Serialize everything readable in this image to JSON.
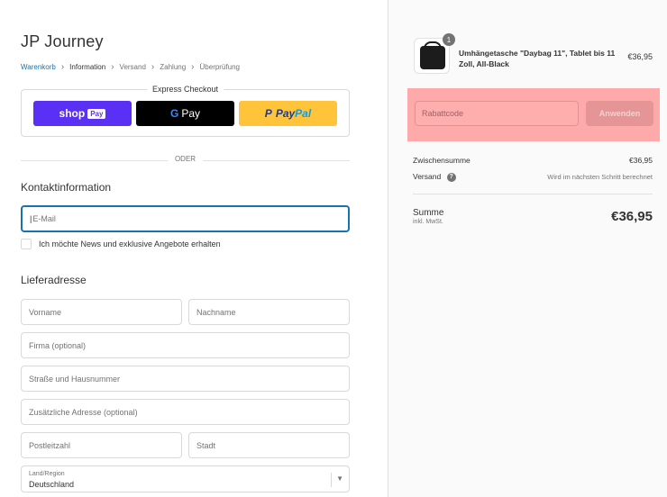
{
  "shop": {
    "title": "JP Journey"
  },
  "breadcrumb": [
    "Warenkorb",
    "Information",
    "Versand",
    "Zahlung",
    "Überprüfung"
  ],
  "express_checkout": {
    "label": "Express Checkout",
    "shop_pay": {
      "text": "shop",
      "tag": "Pay"
    },
    "google_pay": {
      "g": "G",
      "text": "Pay"
    },
    "paypal": {
      "part1": "Pay",
      "part2": "Pal"
    }
  },
  "separator": "ODER",
  "contact": {
    "title": "Kontaktinformation",
    "email_placeholder": "E-Mail",
    "newsletter_label": "Ich möchte News und exklusive Angebote erhalten"
  },
  "shipping": {
    "title": "Lieferadresse",
    "first_name": "Vorname",
    "last_name": "Nachname",
    "company": "Firma (optional)",
    "street": "Straße und Hausnummer",
    "address2": "Zusätzliche Adresse (optional)",
    "zip": "Postleitzahl",
    "city": "Stadt",
    "country_label": "Land/Region",
    "country_value": "Deutschland"
  },
  "summary": {
    "product": {
      "name": "Umhängetasche \"Daybag 11\", Tablet bis 11 Zoll, All-Black",
      "price": "€36,95",
      "quantity": "1"
    },
    "discount_placeholder": "Rabattcode",
    "apply_label": "Anwenden",
    "subtotal_label": "Zwischensumme",
    "subtotal_value": "€36,95",
    "shipping_label": "Versand",
    "shipping_value": "Wird im nächsten Schritt berechnet",
    "total_label": "Summe",
    "total_sub": "inkl. MwSt.",
    "total_value": "€36,95"
  },
  "colors": {
    "accent": "#1773b0",
    "shop_pay": "#5a31f4",
    "paypal": "#ffc439",
    "highlight": "#ffaaaa"
  }
}
